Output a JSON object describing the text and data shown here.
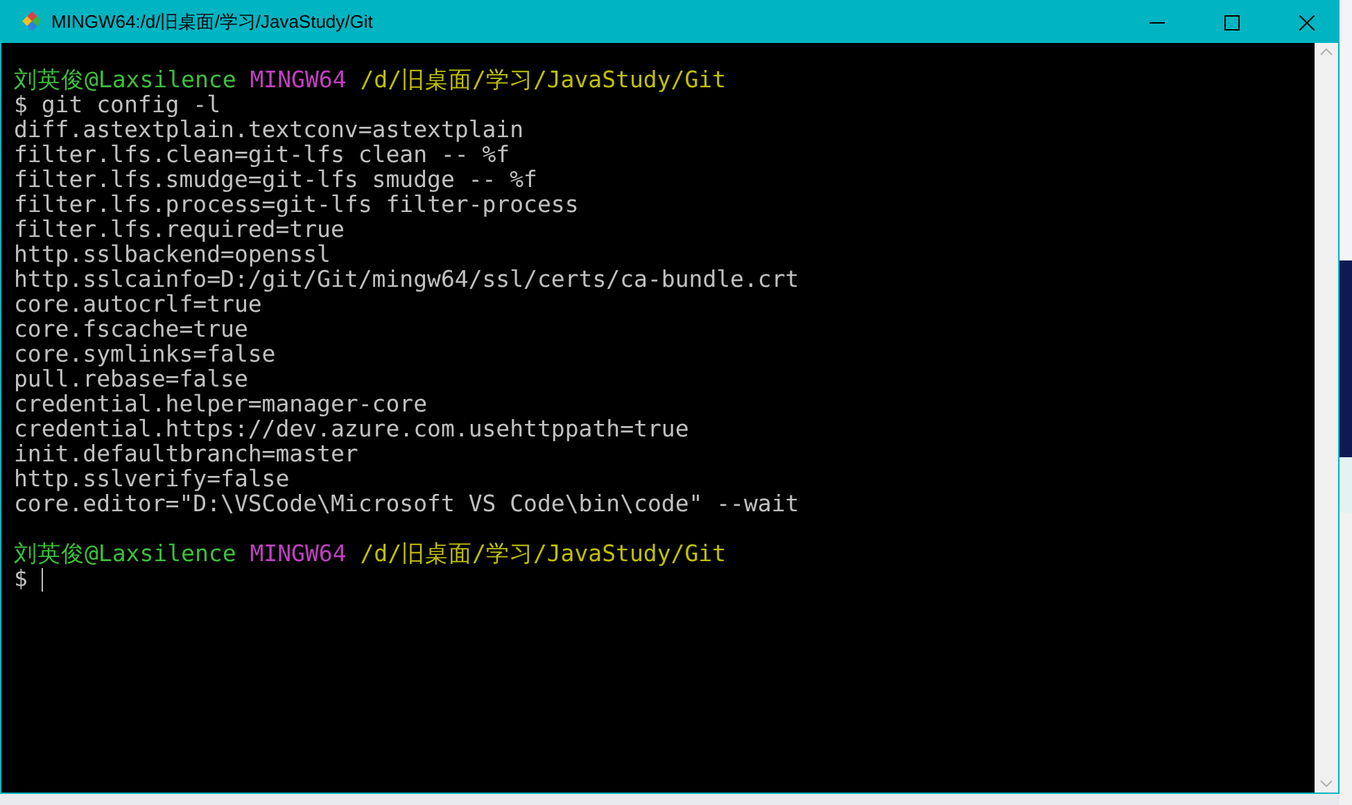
{
  "window": {
    "title": "MINGW64:/d/旧桌面/学习/JavaStudy/Git"
  },
  "lines": [
    {
      "kind": "prompt",
      "user": "刘英俊@Laxsilence",
      "host": "MINGW64",
      "path": "/d/旧桌面/学习/JavaStudy/Git"
    },
    {
      "kind": "command",
      "text": "$ git config -l"
    },
    {
      "kind": "output",
      "text": "diff.astextplain.textconv=astextplain"
    },
    {
      "kind": "output",
      "text": "filter.lfs.clean=git-lfs clean -- %f"
    },
    {
      "kind": "output",
      "text": "filter.lfs.smudge=git-lfs smudge -- %f"
    },
    {
      "kind": "output",
      "text": "filter.lfs.process=git-lfs filter-process"
    },
    {
      "kind": "output",
      "text": "filter.lfs.required=true"
    },
    {
      "kind": "output",
      "text": "http.sslbackend=openssl"
    },
    {
      "kind": "output",
      "text": "http.sslcainfo=D:/git/Git/mingw64/ssl/certs/ca-bundle.crt"
    },
    {
      "kind": "output",
      "text": "core.autocrlf=true"
    },
    {
      "kind": "output",
      "text": "core.fscache=true"
    },
    {
      "kind": "output",
      "text": "core.symlinks=false"
    },
    {
      "kind": "output",
      "text": "pull.rebase=false"
    },
    {
      "kind": "output",
      "text": "credential.helper=manager-core"
    },
    {
      "kind": "output",
      "text": "credential.https://dev.azure.com.usehttppath=true"
    },
    {
      "kind": "output",
      "text": "init.defaultbranch=master"
    },
    {
      "kind": "output",
      "text": "http.sslverify=false"
    },
    {
      "kind": "output",
      "text": "core.editor=\"D:\\VSCode\\Microsoft VS Code\\bin\\code\" --wait"
    },
    {
      "kind": "blank"
    },
    {
      "kind": "prompt",
      "user": "刘英俊@Laxsilence",
      "host": "MINGW64",
      "path": "/d/旧桌面/学习/JavaStudy/Git"
    },
    {
      "kind": "input",
      "text": "$"
    }
  ]
}
